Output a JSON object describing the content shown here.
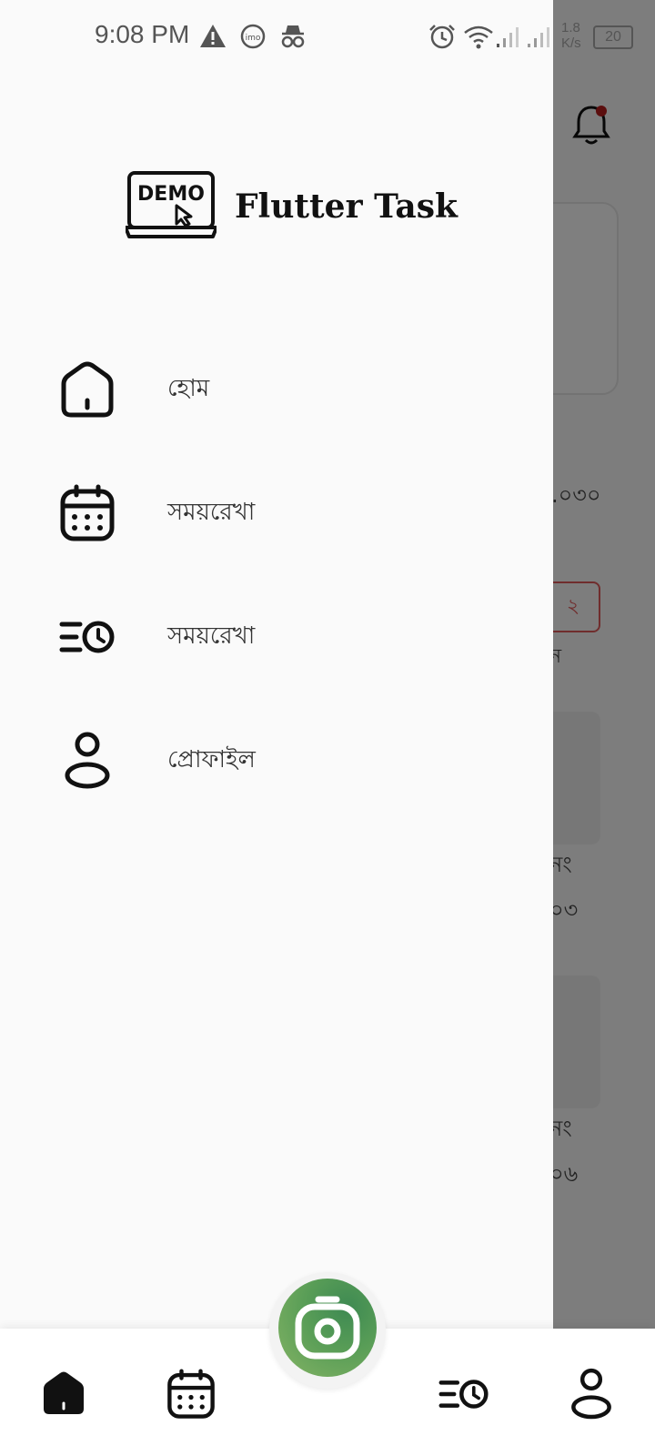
{
  "status_bar": {
    "time": "9:08 PM",
    "net_speed_value": "1.8",
    "net_speed_unit": "K/s",
    "battery": "20",
    "icons": [
      "warning-icon",
      "imo-icon",
      "incognito-icon",
      "alarm-icon",
      "wifi-icon",
      "signal-icon",
      "signal-icon"
    ]
  },
  "drawer": {
    "brand": {
      "logo_text": "DEMO",
      "title": "Flutter Task"
    },
    "menu": [
      {
        "label": "হোম",
        "icon": "home-icon"
      },
      {
        "label": "সময়রেখা",
        "icon": "calendar-icon"
      },
      {
        "label": "সময়রেখা",
        "icon": "timeline-clock-icon"
      },
      {
        "label": "প্রোফাইল",
        "icon": "profile-icon"
      }
    ]
  },
  "background_page": {
    "snippets": [
      ".০৩০",
      "২",
      "ন",
      "নং",
      "০৩",
      "নং",
      "০৬"
    ]
  },
  "bottom_nav": {
    "items": [
      "home-icon",
      "calendar-icon",
      "camera-icon",
      "timeline-clock-icon",
      "profile-icon"
    ]
  },
  "colors": {
    "fab_gradient_start": "#3e8a52",
    "fab_gradient_end": "#86b465",
    "drawer_bg": "#fafafa",
    "notification_dot": "#b71c1c",
    "badge_border": "#e05a5a"
  }
}
